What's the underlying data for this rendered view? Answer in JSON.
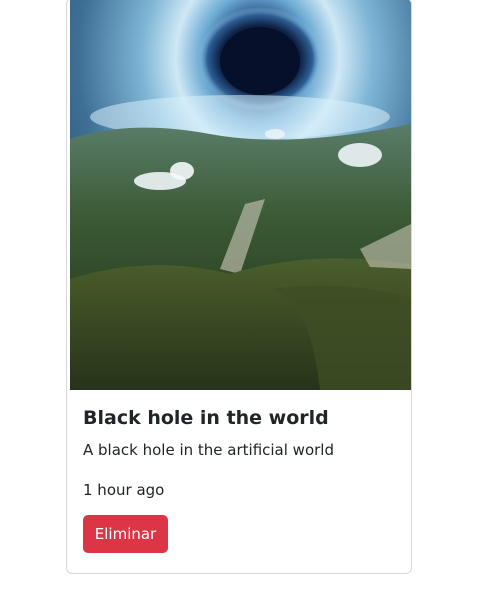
{
  "card": {
    "title": "Black hole in the world",
    "description": "A black hole in the artificial world",
    "timestamp": "1 hour ago",
    "delete_label": "Eliminar"
  },
  "colors": {
    "danger": "#dc3545",
    "text": "#212529",
    "border": "#d6d8db"
  }
}
